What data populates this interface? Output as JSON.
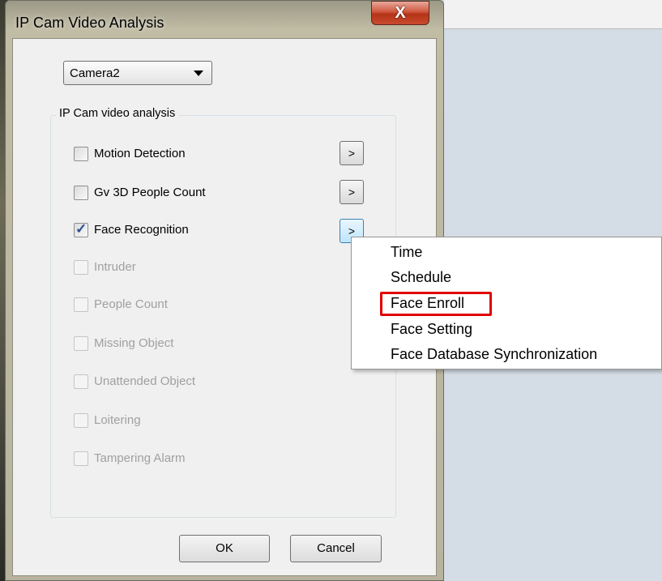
{
  "dialog": {
    "title": "IP Cam Video Analysis",
    "close_symbol": "X"
  },
  "camera_select": {
    "value": "Camera2"
  },
  "group": {
    "label": "IP Cam video analysis",
    "items": [
      {
        "label": "Motion Detection",
        "checked": false,
        "enabled": true
      },
      {
        "label": "Gv 3D People Count",
        "checked": false,
        "enabled": true
      },
      {
        "label": "Face Recognition",
        "checked": true,
        "enabled": true
      },
      {
        "label": "Intruder",
        "checked": false,
        "enabled": false
      },
      {
        "label": "People Count",
        "checked": false,
        "enabled": false
      },
      {
        "label": "Missing Object",
        "checked": false,
        "enabled": false
      },
      {
        "label": "Unattended Object",
        "checked": false,
        "enabled": false
      },
      {
        "label": "Loitering",
        "checked": false,
        "enabled": false
      },
      {
        "label": "Tampering Alarm",
        "checked": false,
        "enabled": false
      }
    ],
    "arrow_label": ">"
  },
  "buttons": {
    "ok": "OK",
    "cancel": "Cancel"
  },
  "context_menu": {
    "items": [
      "Time",
      "Schedule",
      "Face Enroll",
      "Face Setting",
      "Face Database Synchronization"
    ],
    "highlighted": "Face Enroll",
    "highlight_color": "#e00000"
  },
  "colors": {
    "close_button": "#c94a2d",
    "active_arrow_border": "#3c7fb1",
    "disabled_text": "#a0a0a0"
  }
}
